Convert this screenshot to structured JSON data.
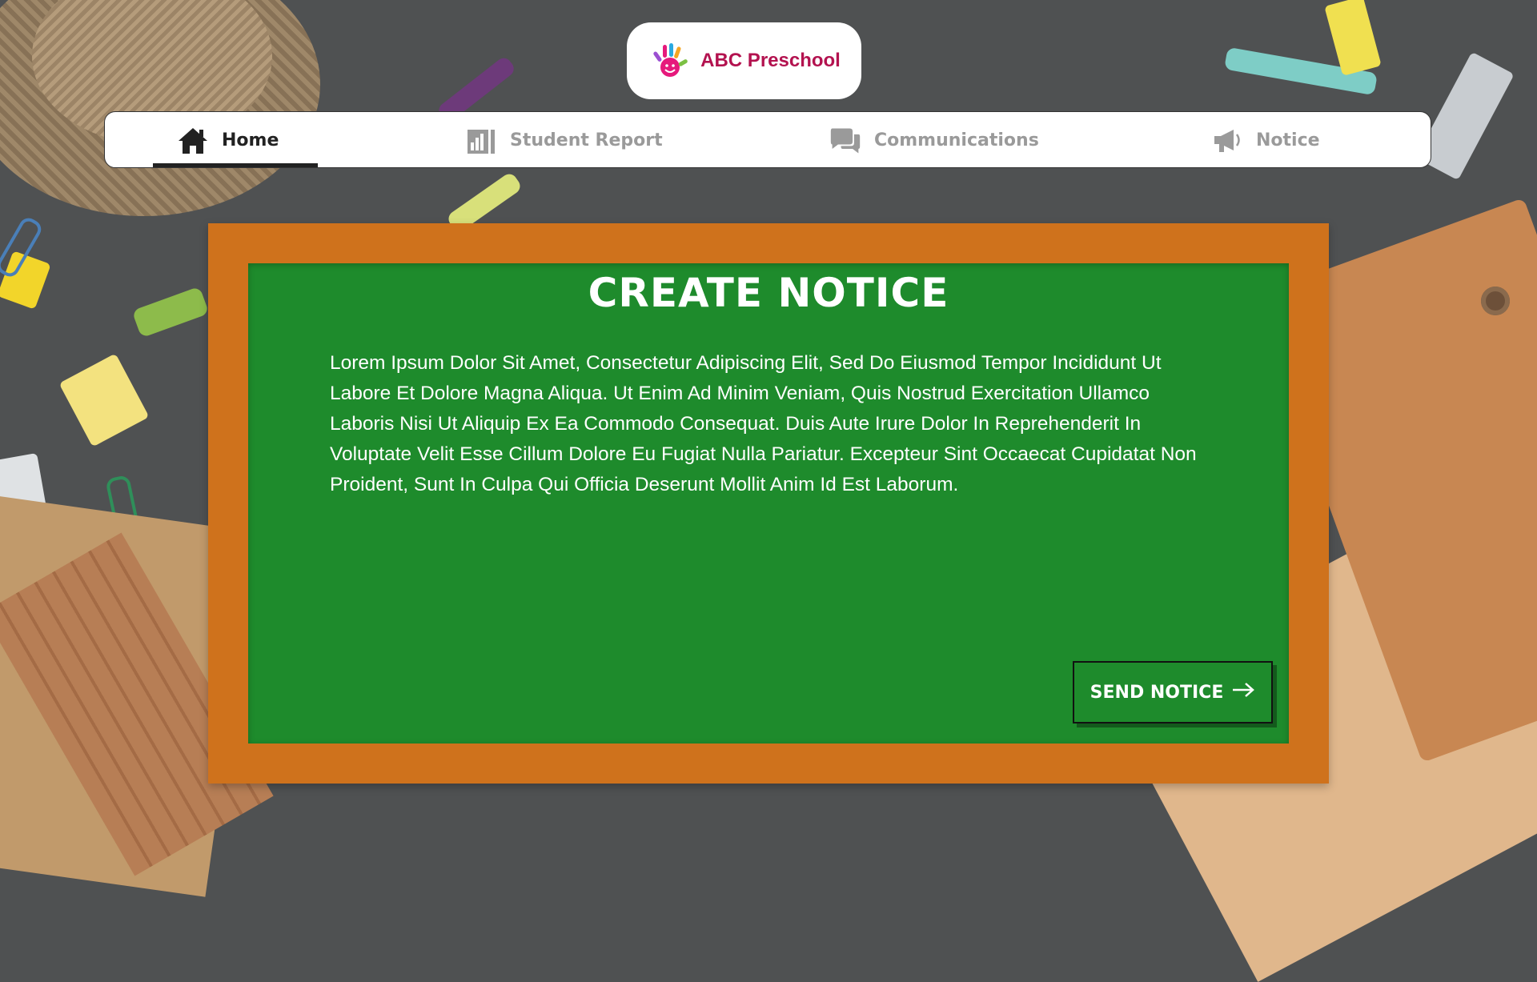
{
  "app": {
    "logo_text": "ABC Preschool"
  },
  "nav": {
    "items": [
      {
        "label": "Home",
        "icon": "home-icon",
        "active": true
      },
      {
        "label": "Student Report",
        "icon": "report-icon",
        "active": false
      },
      {
        "label": "Communications",
        "icon": "chat-icon",
        "active": false
      },
      {
        "label": "Notice",
        "icon": "megaphone-icon",
        "active": false
      }
    ]
  },
  "notice": {
    "title": "CREATE NOTICE",
    "body": "Lorem Ipsum Dolor Sit Amet, Consectetur Adipiscing Elit, Sed Do Eiusmod Tempor Incididunt Ut Labore Et Dolore Magna Aliqua. Ut Enim Ad Minim Veniam, Quis Nostrud Exercitation Ullamco Laboris Nisi Ut Aliquip Ex Ea Commodo Consequat. Duis Aute Irure Dolor In Reprehenderit In Voluptate Velit Esse Cillum Dolore Eu Fugiat Nulla Pariatur. Excepteur Sint Occaecat Cupidatat Non Proident, Sunt In Culpa Qui Officia Deserunt Mollit Anim Id Est Laborum.",
    "send_label": "SEND NOTICE",
    "send_icon": "arrow-right-icon"
  },
  "colors": {
    "frame": "#cf721c",
    "board": "#1e8b2c",
    "logo_text": "#b3124f",
    "nav_active": "#222222",
    "nav_inactive": "#9a9a9a"
  }
}
